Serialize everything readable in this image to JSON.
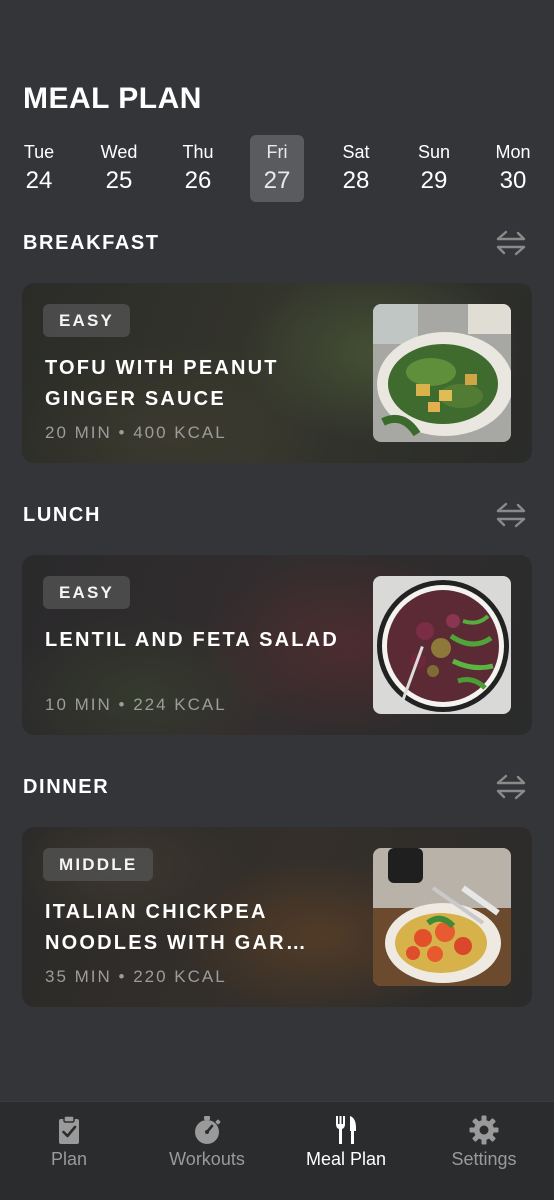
{
  "header": {
    "title": "MEAL PLAN"
  },
  "days": [
    {
      "name": "Tue",
      "date": "24",
      "selected": false
    },
    {
      "name": "Wed",
      "date": "25",
      "selected": false
    },
    {
      "name": "Thu",
      "date": "26",
      "selected": false
    },
    {
      "name": "Fri",
      "date": "27",
      "selected": true
    },
    {
      "name": "Sat",
      "date": "28",
      "selected": false
    },
    {
      "name": "Sun",
      "date": "29",
      "selected": false
    },
    {
      "name": "Mon",
      "date": "30",
      "selected": false
    }
  ],
  "meals": {
    "breakfast": {
      "section_title": "BREAKFAST",
      "difficulty": "EASY",
      "name": "TOFU WITH PEANUT GINGER SAUCE",
      "meta": "20 MIN • 400 KCAL",
      "swap_icon": "swap-arrows-icon"
    },
    "lunch": {
      "section_title": "LUNCH",
      "difficulty": "EASY",
      "name": "LENTIL AND FETA SALAD",
      "meta": "10 MIN • 224 KCAL",
      "swap_icon": "swap-arrows-icon"
    },
    "dinner": {
      "section_title": "DINNER",
      "difficulty": "MIDDLE",
      "name": "ITALIAN CHICKPEA NOODLES WITH GAR…",
      "meta": "35 MIN • 220 KCAL",
      "swap_icon": "swap-arrows-icon"
    }
  },
  "tabbar": {
    "tabs": [
      {
        "label": "Plan",
        "icon": "clipboard-check-icon",
        "active": false
      },
      {
        "label": "Workouts",
        "icon": "stopwatch-icon",
        "active": false
      },
      {
        "label": "Meal Plan",
        "icon": "fork-knife-icon",
        "active": true
      },
      {
        "label": "Settings",
        "icon": "gear-icon",
        "active": false
      }
    ]
  },
  "colors": {
    "background": "#333538",
    "tabbar": "#2b2c2e",
    "selected_day": "#5a5b5e",
    "muted_text": "#9c9c9c"
  }
}
